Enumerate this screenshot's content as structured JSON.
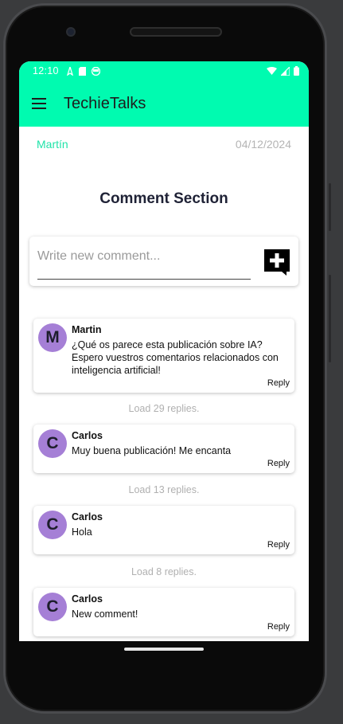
{
  "status": {
    "time": "12:10"
  },
  "app": {
    "title": "TechieTalks"
  },
  "post": {
    "author": "Martín",
    "date": "04/12/2024"
  },
  "section": {
    "title": "Comment Section"
  },
  "new_comment": {
    "placeholder": "Write new comment..."
  },
  "comments": [
    {
      "initial": "M",
      "name": "Martin",
      "text": "¿Qué os parece esta publicación sobre IA? Espero vuestros comentarios relacionados con inteligencia artificial!",
      "reply": "Reply",
      "load_replies": "Load 29 replies."
    },
    {
      "initial": "C",
      "name": "Carlos",
      "text": "Muy buena publicación! Me encanta",
      "reply": "Reply",
      "load_replies": "Load 13 replies."
    },
    {
      "initial": "C",
      "name": "Carlos",
      "text": "Hola",
      "reply": "Reply",
      "load_replies": "Load 8 replies."
    },
    {
      "initial": "C",
      "name": "Carlos",
      "text": "New comment!",
      "reply": "Reply"
    }
  ],
  "colors": {
    "accent": "#00fbb0",
    "author": "#1fe3a8",
    "avatar": "#a57fd6"
  }
}
